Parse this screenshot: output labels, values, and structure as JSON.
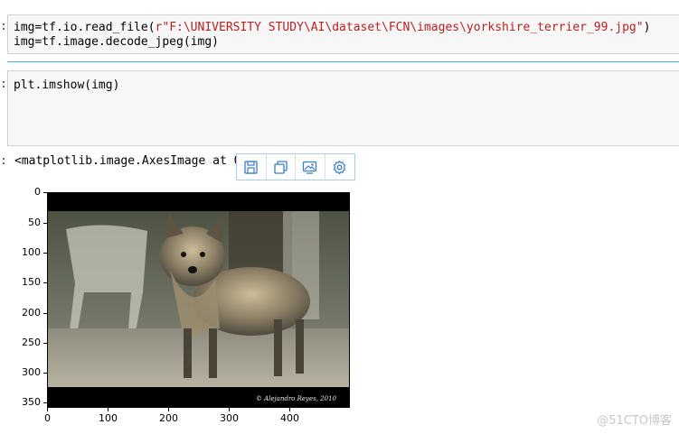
{
  "cells": {
    "cell1": {
      "line1_prefix": "img=tf.io.read_file(",
      "line1_string": "r\"F:\\UNIVERSITY STUDY\\AI\\dataset\\FCN\\images\\yorkshire_terrier_99.jpg\"",
      "line1_suffix": ")",
      "line2": "img=tf.image.decode_jpeg(img)"
    },
    "cell2": {
      "line1": "plt.imshow(img)"
    },
    "output": {
      "text": "<matplotlib.image.AxesImage at 0"
    }
  },
  "toolbar": {
    "buttons": [
      {
        "icon": "save-icon"
      },
      {
        "icon": "copy-icon"
      },
      {
        "icon": "image-icon"
      },
      {
        "icon": "gear-icon"
      }
    ]
  },
  "plot": {
    "image_caption": "© Alejandro Reyes, 2010",
    "y_ticks": [
      "0",
      "50",
      "100",
      "150",
      "200",
      "250",
      "300",
      "350"
    ],
    "x_ticks": [
      "0",
      "100",
      "200",
      "300",
      "400"
    ]
  },
  "watermark": "@51CTO博客",
  "colors": {
    "accent": "#42a5f5",
    "string": "#ba2121"
  }
}
